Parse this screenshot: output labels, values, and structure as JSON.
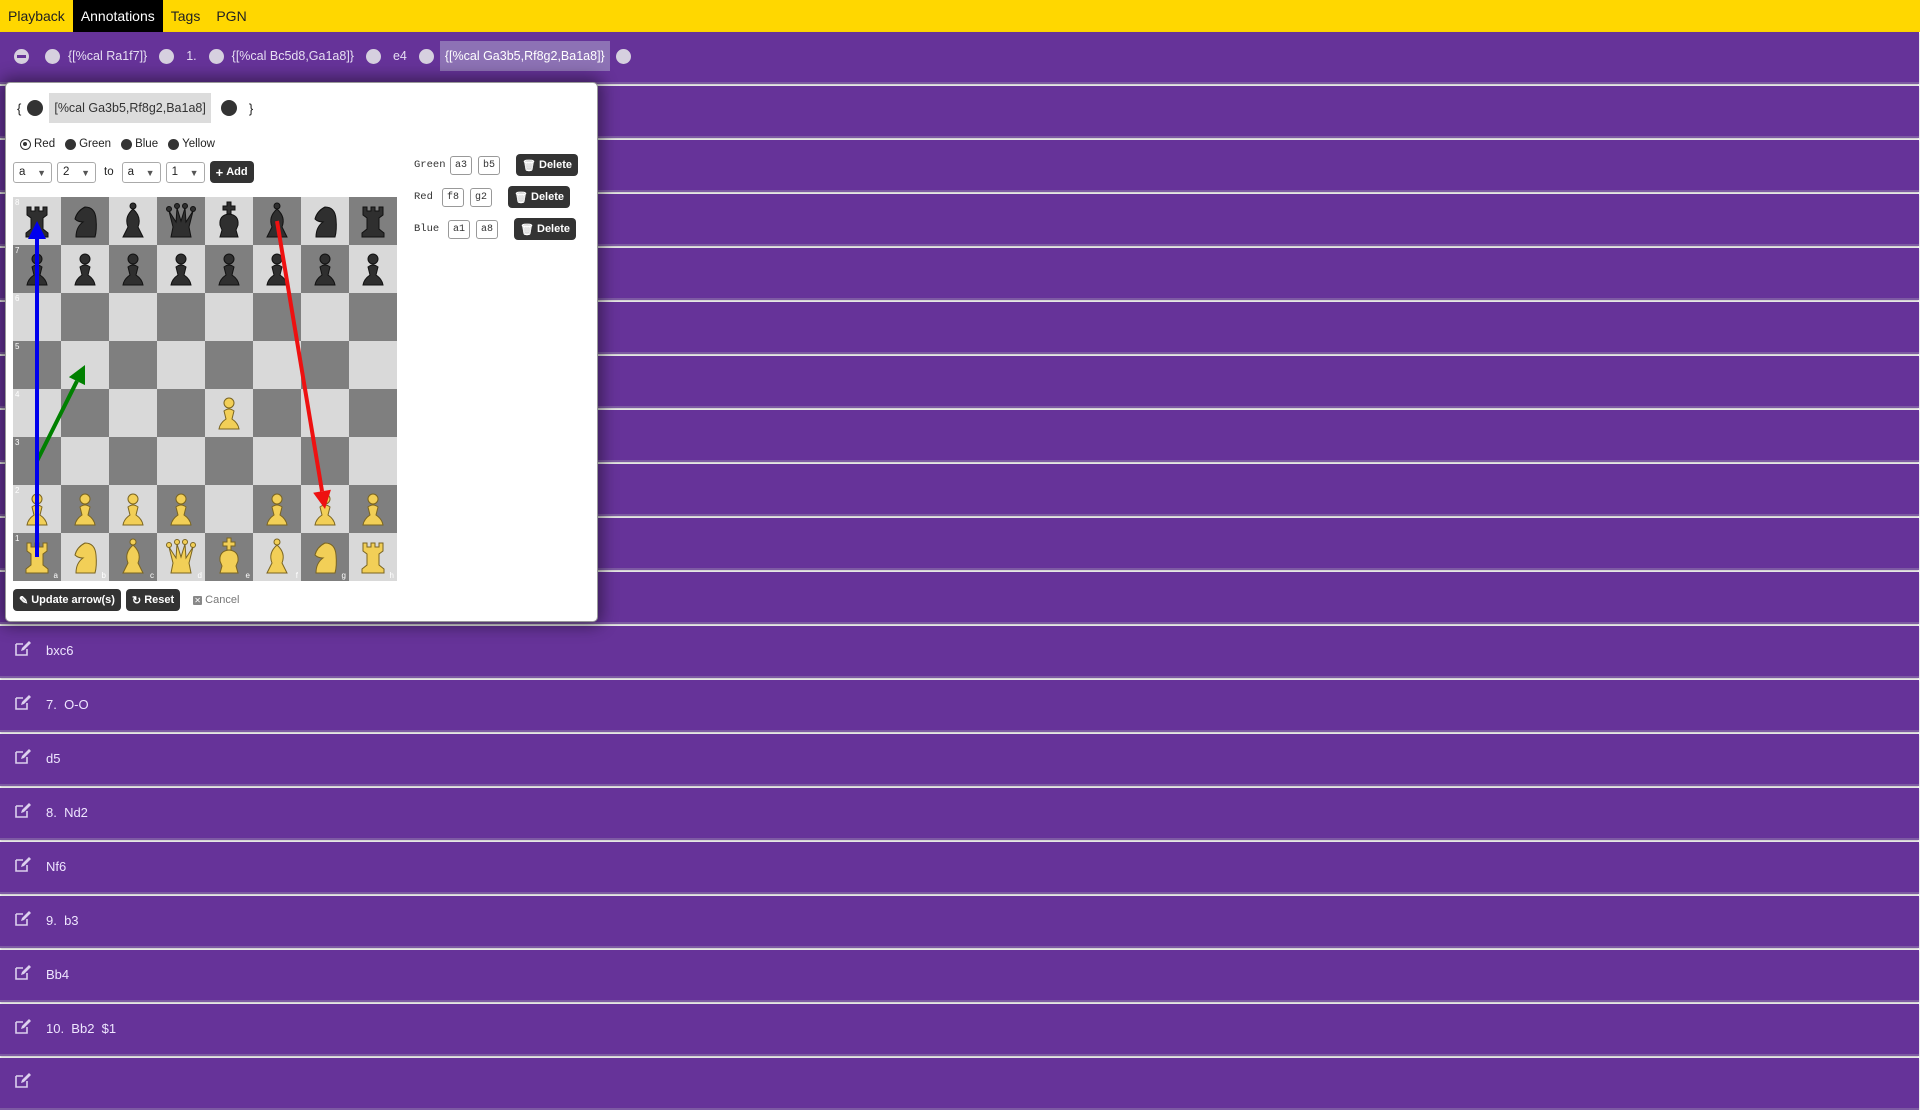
{
  "nav": {
    "tabs": [
      {
        "label": "Playback",
        "active": false
      },
      {
        "label": "Annotations",
        "active": true
      },
      {
        "label": "Tags",
        "active": false
      },
      {
        "label": "PGN",
        "active": false
      }
    ]
  },
  "first_row": {
    "tokens": [
      "{[%cal Ra1f7]}",
      "1.",
      "{[%cal Bc5d8,Ga1a8]}",
      "e4",
      "{[%cal Ga3b5,Rf8g2,Ba1a8]}"
    ]
  },
  "popover": {
    "open_brace": "{",
    "close_brace": "}",
    "comment": "[%cal Ga3b5,Rf8g2,Ba1a8]",
    "colors": [
      {
        "label": "Red",
        "checked": true
      },
      {
        "label": "Green",
        "checked": false
      },
      {
        "label": "Blue",
        "checked": false
      },
      {
        "label": "Yellow",
        "checked": false
      }
    ],
    "from_file": "a",
    "from_rank": "2",
    "to_label": "to",
    "to_file": "a",
    "to_rank": "1",
    "add_label": "Add",
    "arrows": [
      {
        "color": "Green",
        "from": "a3",
        "to": "b5",
        "delete_label": "Delete"
      },
      {
        "color": "Red",
        "from": "f8",
        "to": "g2",
        "delete_label": "Delete"
      },
      {
        "color": "Blue",
        "from": "a1",
        "to": "a8",
        "delete_label": "Delete"
      }
    ],
    "update_label": "Update arrow(s)",
    "reset_label": "Reset",
    "cancel_label": "Cancel",
    "board": {
      "files": [
        "a",
        "b",
        "c",
        "d",
        "e",
        "f",
        "g",
        "h"
      ],
      "ranks": [
        "8",
        "7",
        "6",
        "5",
        "4",
        "3",
        "2",
        "1"
      ],
      "pieces": {
        "a8": "bR",
        "b8": "bN",
        "c8": "bB",
        "d8": "bQ",
        "e8": "bK",
        "f8": "bB",
        "g8": "bN",
        "h8": "bR",
        "a7": "bP",
        "b7": "bP",
        "c7": "bP",
        "d7": "bP",
        "e7": "bP",
        "f7": "bP",
        "g7": "bP",
        "h7": "bP",
        "e4": "wP",
        "a2": "wP",
        "b2": "wP",
        "c2": "wP",
        "d2": "wP",
        "f2": "wP",
        "g2": "wP",
        "h2": "wP",
        "a1": "wR",
        "b1": "wN",
        "c1": "wB",
        "d1": "wQ",
        "e1": "wK",
        "f1": "wB",
        "g1": "wN",
        "h1": "wR"
      },
      "arrow_colors": {
        "Green": "#008000",
        "Red": "#ee1111",
        "Blue": "#0000ee"
      }
    }
  },
  "moves": [
    {
      "text": "bxc6"
    },
    {
      "text": "7.  O-O"
    },
    {
      "text": "d5"
    },
    {
      "text": "8.  Nd2"
    },
    {
      "text": "Nf6"
    },
    {
      "text": "9.  b3"
    },
    {
      "text": "Bb4"
    },
    {
      "text": "10.  Bb2  $1"
    },
    {
      "text": ""
    }
  ],
  "colors": {
    "nav": "#ffd700",
    "row": "#663399",
    "board_light": "#d9d9d9",
    "board_dark": "#7f7f7f"
  }
}
